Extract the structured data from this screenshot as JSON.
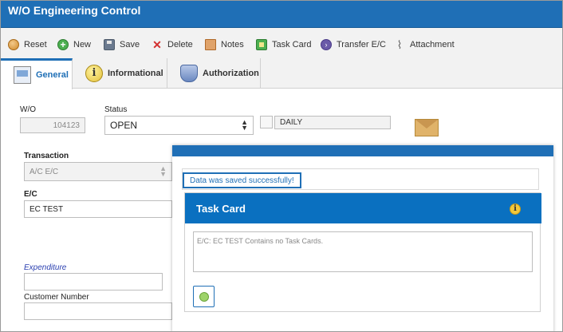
{
  "window": {
    "title": "W/O Engineering Control"
  },
  "toolbar": {
    "items": [
      {
        "label": "Reset",
        "icon": "reset-icon"
      },
      {
        "label": "New",
        "icon": "plus-circle-icon"
      },
      {
        "label": "Save",
        "icon": "save-icon"
      },
      {
        "label": "Delete",
        "icon": "delete-x-icon"
      },
      {
        "label": "Notes",
        "icon": "notes-icon"
      },
      {
        "label": "Task Card",
        "icon": "task-card-icon"
      },
      {
        "label": "Transfer E/C",
        "icon": "transfer-icon"
      },
      {
        "label": "Attachment",
        "icon": "paperclip-icon"
      }
    ]
  },
  "tabs": [
    {
      "label": "General",
      "active": true
    },
    {
      "label": "Informational",
      "active": false
    },
    {
      "label": "Authorization",
      "active": false
    }
  ],
  "form": {
    "wo_label": "W/O",
    "wo_value": "104123",
    "status_label": "Status",
    "status_value": "OPEN",
    "daily_label": "DAILY",
    "transaction_label": "Transaction",
    "transaction_value": "A/C E/C",
    "ec_label": "E/C",
    "ec_value": "EC TEST",
    "expenditure_label": "Expenditure",
    "expenditure_value": "",
    "customer_number_label": "Customer Number",
    "customer_number_value": ""
  },
  "modal": {
    "message": "Data was saved successfully!",
    "panel_title": "Task Card",
    "empty_text": "E/C: EC TEST Contains no Task Cards."
  },
  "colors": {
    "titlebar": "#1f6fb6",
    "panel_header": "#0a70c0"
  }
}
